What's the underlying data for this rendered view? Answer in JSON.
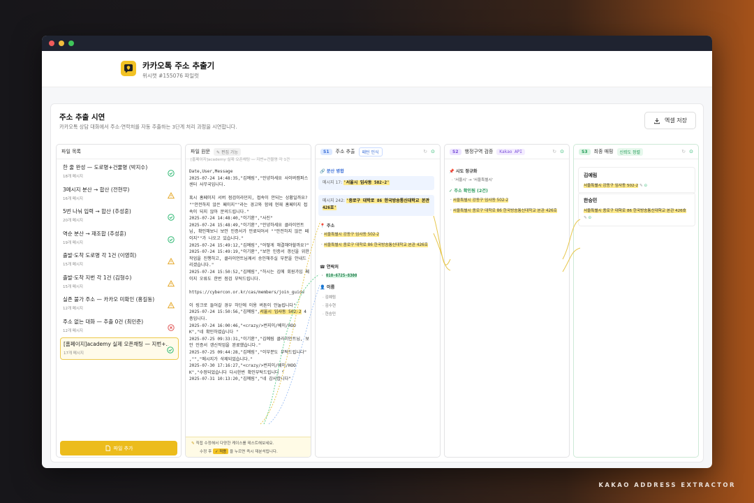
{
  "app": {
    "title": "카카오톡 주소 추출기",
    "subtitle": "위시캣 #155076 파일럿"
  },
  "card": {
    "title": "주소 추출 시연",
    "subtitle": "카카오톡 상담 대화에서 주소·연락처를 자동 추출하는 3단계 처리 과정을 시연합니다.",
    "excel_label": "엑셀 저장"
  },
  "files": {
    "header": "파일 목록",
    "add_label": "파일 추가",
    "items": [
      {
        "name": "한 줄 완성 — 도로명+건물명 (박지수)",
        "count": "18개 메시지",
        "status": "ok"
      },
      {
        "name": "3메시지 분산 → 합산 (전현무)",
        "count": "16개 메시지",
        "status": "warn"
      },
      {
        "name": "5번 나눠 입력 → 합산 (추성훈)",
        "count": "20개 메시지",
        "status": "ok"
      },
      {
        "name": "역순 분산 → 재조합 (추성훈)",
        "count": "19개 메시지",
        "status": "ok"
      },
      {
        "name": "출발·도착 도로명 각 1건 (이영희)",
        "count": "15개 메시지",
        "status": "warn"
      },
      {
        "name": "출발·도착 지번 각 1건 (김형수)",
        "count": "15개 메시지",
        "status": "warn"
      },
      {
        "name": "실존 불가 주소 — 카카오 미확인 (홍길동)",
        "count": "12개 메시지",
        "status": "warn"
      },
      {
        "name": "주소 없는 대화 — 추출 0건 (최민준)",
        "count": "12개 메시지",
        "status": "err"
      },
      {
        "name": "[홈페이지]academy 실제 오픈채팅 — 지번+…",
        "count": "17개 메시지",
        "status": "ok"
      }
    ]
  },
  "raw": {
    "header": "파일 원문",
    "edit_badge": "편집 가능",
    "filename": "[홈페이지]academy 실제 오픈채팅 — 지번+건물명 각 1건",
    "text_before": "Date,User,Message\n2025-07-24 14:48:35,\"김예림\",\"안녕하세요 사이버캠퍼스센터 사무국입니다.\n\n혹시 홈페이지 서버 점검이라던지, 접속이 안되는 상황일까요?\n\"\"안전하지 않은 페이지\"\"라는 경고와 함께 현재 홈페이지 접속이 되지 않아 문의드립니다.\"\n2025-07-24 14:48:40,\"이기환\",\"사진\"\n2025-07-24 15:48:49,\"이기환\",\"안녕하세요 클라이언트님, 확인해보니 보안 인증서가 만료되어서 \"\"안전하지 않은 페이지\"\"가 나오고 있습니다.\"\n2025-07-24 15:49:12,\"김예림\",\"어떻게 해결해야할까요?\"\n2025-07-24 15:49:19,\"이기환\",\"보안 인증서 갱신을 위한 작업을 진행하고, 클라이언트님께서 승인해주실 부분을 안내드리겠습니다.\"\n2025-07-24 15:50:52,\"김예림\",\"하시는 김에 회원가입 페이지 오류도 한번 점검 부탁드립니다.\n\nhttps://cybercon.or.kr/cas/members/join_guide\n\n이 링크로 들어갈 경우 하단에 이용 버튼이 안눌립니다\"\n2025-07-24 15:50:56,\"김예림\",",
    "text_hl": "서울시 임사동 502-2",
    "text_after": " 4층입니다.\n2025-07-24 16:00:46,\"<crazy/>번지이/베이/HOOK\",\"네 확인하였습니다 \"\n2025-07-25 09:33:31,\"이기환\",\"김예림 클라이언트님, 보안 인증서 갱신작업을 완료했습니다.\"\n2025-07-25 09:44:28,\"김예림\",\"이부분도 부탁드립니다\"\n,\"\",\"메시지가 삭제되었습니다.\"\n2025-07-30 17:16:27,\"<crazy/>번지이/베이/HOOK\",\"수정되었습니다 다시한번 확인부탁드립니다 \"\n2025-07-31 10:13:20,\"김예림\",\"네 감사합니다\"",
    "tip_line1": "직접 수정해서 다양한 케이스를 테스트해보세요.",
    "tip_line2_a": "수정 후",
    "tip_chip": "적용",
    "tip_line2_b": "을 누르면 즉시 재분석됩니다."
  },
  "s1": {
    "tag": "S1",
    "title": "주소 추출",
    "badge": "패턴 인식",
    "merge_title": "분산 병합",
    "msg1_prefix": "메시지 17:",
    "msg1_text": "'서울시 임사동 502-2'",
    "msg2_prefix": "메시지 242:",
    "msg2_text": "'종로구 대학로 86 한국방송통신대학교 본관 426호'",
    "addr_title": "주소",
    "addr1": "서울특별시 강동구 임사동 502-2",
    "addr2": "서울특별시 종로구 대학로 86 한국방송통신대학교 본관 426호",
    "contact_title": "연락처",
    "phone": "010-6725-8300",
    "name_title": "이름",
    "names": [
      "김예림",
      "김수현",
      "한승민"
    ]
  },
  "s2": {
    "tag": "S2",
    "title": "행정구역 검증",
    "badge": "Kakao API",
    "norm_title": "시도 정규화",
    "norm_rule": "'서울시' → '서울특별시'",
    "confirmed_title": "주소 확인됨 (2건)",
    "addr1": "서울특별시 강동구 임사동 502-2",
    "addr2": "서울특별시 종로구 대학로 86 한국방송통신대학교 본관 426호"
  },
  "s3": {
    "tag": "S3",
    "title": "최종 매핑",
    "badge": "신뢰도 정렬",
    "people": [
      {
        "name": "김예림",
        "addr": "서울특별시 강동구 임사동 502-2"
      },
      {
        "name": "한승민",
        "addr": "서울특별시 종로구 대학로 86 한국방송통신대학교 본관 426호"
      }
    ]
  },
  "footer": "KAKAO ADDRESS EXTRACTOR",
  "colors": {
    "accent": "#f2c224",
    "ok": "#2eb872",
    "warn": "#e5a82a",
    "err": "#e05656",
    "s1": "#3b82f6",
    "s2": "#8b5cf6",
    "s3": "#22c55e"
  }
}
